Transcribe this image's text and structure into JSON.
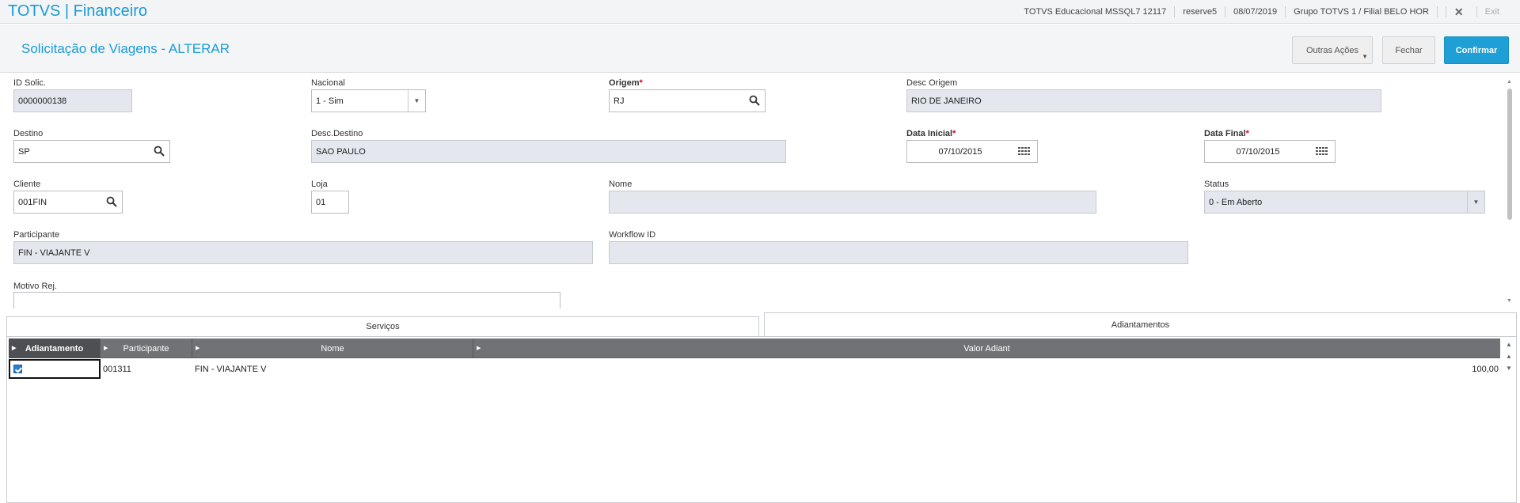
{
  "topbar": {
    "app_title": "TOTVS | Financeiro",
    "environment": "TOTVS Educacional MSSQL7 12117",
    "user": "reserve5",
    "date": "08/07/2019",
    "branch": "Grupo TOTVS 1 / Filial BELO HOR",
    "exit_label": "Exit"
  },
  "header": {
    "title": "Solicitação de Viagens - ALTERAR",
    "other_actions_label": "Outras Ações",
    "close_label": "Fechar",
    "confirm_label": "Confirmar"
  },
  "form": {
    "id_solic": {
      "label": "ID Solic.",
      "value": "0000000138"
    },
    "nacional": {
      "label": "Nacional",
      "value": "1 - Sim"
    },
    "origem": {
      "label": "Origem",
      "required": "*",
      "value": "RJ"
    },
    "desc_origem": {
      "label": "Desc Origem",
      "value": "RIO DE JANEIRO"
    },
    "destino": {
      "label": "Destino",
      "value": "SP"
    },
    "desc_destino": {
      "label": "Desc.Destino",
      "value": "SAO PAULO"
    },
    "data_inicial": {
      "label": "Data Inicial",
      "required": "*",
      "value": "07/10/2015"
    },
    "data_final": {
      "label": "Data Final",
      "required": "*",
      "value": "07/10/2015"
    },
    "cliente": {
      "label": "Cliente",
      "value": "001FIN"
    },
    "loja": {
      "label": "Loja",
      "value": "01"
    },
    "nome": {
      "label": "Nome",
      "value": ""
    },
    "status": {
      "label": "Status",
      "value": "0 - Em Aberto"
    },
    "participante": {
      "label": "Participante",
      "value": "FIN - VIAJANTE V"
    },
    "workflow_id": {
      "label": "Workflow ID",
      "value": ""
    },
    "motivo_rej": {
      "label": "Motivo Rej.",
      "value": ""
    }
  },
  "tabs": [
    {
      "label": "Serviços"
    },
    {
      "label": "Adiantamentos"
    }
  ],
  "grid": {
    "columns": [
      "Adiantamento",
      "Participante",
      "Nome",
      "Valor Adiant"
    ],
    "rows": [
      {
        "adiantamento": "",
        "participante": "001311",
        "nome": "FIN - VIAJANTE V",
        "valor": "100,00"
      }
    ]
  },
  "colors": {
    "accent": "#1a9bd7",
    "confirm": "#1e9fd6",
    "required": "#d9001b",
    "grid_header": "#707276"
  }
}
